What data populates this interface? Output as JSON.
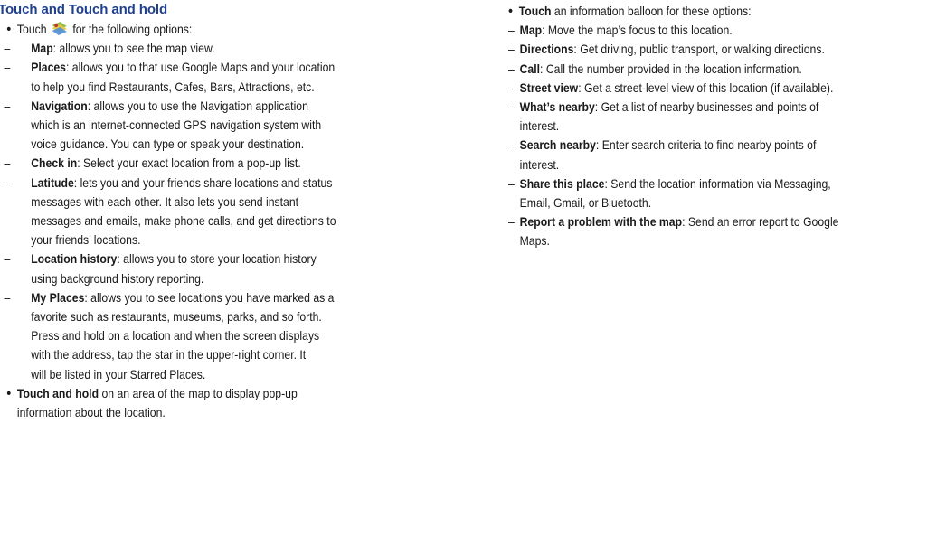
{
  "heading": "Touch and Touch and hold",
  "left": {
    "touch_intro_pre": "Touch",
    "touch_intro_post": "for the following options:",
    "icon": "layers-icon",
    "items": [
      {
        "term": "Map",
        "lines": [
          ": allows you to see the map view."
        ]
      },
      {
        "term": "Places",
        "lines": [
          ": allows you to that use Google Maps and your location",
          "to help you find Restaurants, Cafes, Bars, Attractions, etc."
        ]
      },
      {
        "term": "Navigation",
        "lines": [
          ": allows you to use the Navigation application",
          "which is an internet-connected GPS navigation system with",
          "voice guidance. You can type or speak your destination."
        ]
      },
      {
        "term": "Check in",
        "lines": [
          ": Select your exact location from a pop-up list."
        ]
      },
      {
        "term": "Latitude",
        "lines": [
          ": lets you and your friends share locations and status",
          "messages with each other. It also lets you send instant",
          "messages and emails, make phone calls, and get directions to",
          "your friends’ locations."
        ]
      },
      {
        "term": "Location history",
        "lines": [
          ": allows you to store your location history",
          "using background history reporting."
        ]
      },
      {
        "term": "My Places",
        "lines": [
          ": allows you to see locations you have marked as a",
          "favorite such as restaurants, museums, parks, and so forth.",
          "Press and hold on a location and when the screen displays",
          "with the address, tap the star in the upper-right corner. It",
          "will be listed in your Starred Places."
        ]
      }
    ],
    "hold": {
      "term": "Touch and hold",
      "lines": [
        " on an area of the map to display pop-up",
        "information about the location."
      ]
    }
  },
  "right": {
    "intro": {
      "term": "Touch",
      "text": " an information balloon for these options:"
    },
    "items": [
      {
        "term": "Map",
        "lines": [
          ": Move the map’s focus to this location."
        ]
      },
      {
        "term": "Directions",
        "lines": [
          ": Get driving, public transport, or walking directions."
        ]
      },
      {
        "term": "Call",
        "lines": [
          ": Call the number provided in the location information."
        ]
      },
      {
        "term": "Street view",
        "lines": [
          ": Get a street-level view of this location (if available)."
        ]
      },
      {
        "term": "What’s nearby",
        "lines": [
          ": Get a list of nearby businesses and points of",
          "interest."
        ]
      },
      {
        "term": "Search nearby",
        "lines": [
          ": Enter search criteria to find nearby points of",
          "interest."
        ]
      },
      {
        "term": "Share this place",
        "lines": [
          ": Send the location information via Messaging,",
          "Email, Gmail, or Bluetooth."
        ]
      },
      {
        "term": "Report a problem with the map",
        "lines": [
          ": Send an error report to Google",
          "Maps."
        ]
      }
    ]
  }
}
